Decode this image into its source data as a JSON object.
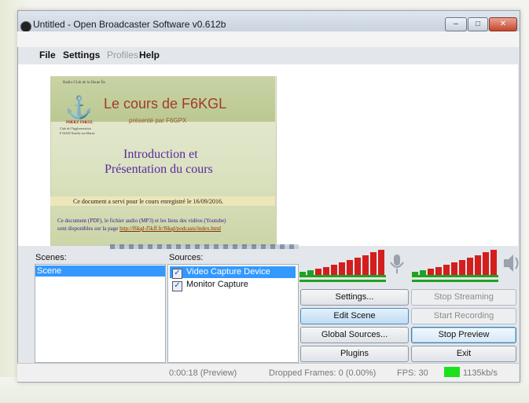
{
  "window": {
    "title": "Untitled - Open Broadcaster Software v0.612b",
    "controls": {
      "minimize": "–",
      "maximize": "□",
      "close": "✕"
    }
  },
  "menu": [
    {
      "label": "File",
      "enabled": true
    },
    {
      "label": "Settings",
      "enabled": true
    },
    {
      "label": "Profiles",
      "enabled": false
    },
    {
      "label": "Help",
      "enabled": true
    }
  ],
  "preview_slide": {
    "small_header": "Radio-Club de la Haute Île",
    "logo_text": "F6KKZ F6KGL",
    "logo_sub1": "Club de l'Agglomeration",
    "logo_sub2": "F-94100 Neuilly-sur-Marne",
    "title": "Le cours de F6KGL",
    "subtitle": "présenté par F6GPX",
    "intro_line1": "Introduction et",
    "intro_line2": "Présentation  du cours",
    "note": "Ce document a servi pour le cours enregistré le 16/09/2016.",
    "info_line1": "Ce document (PDF), le fichier audio (MP3) et les liens des vidéos (Youtube)",
    "info_line2_prefix": "sont disponibles sur la page ",
    "info_link": "http://f6kgl-f5kff.fr/f6kgl/podcasts/index.html"
  },
  "scenes": {
    "label": "Scenes:",
    "items": [
      "Scene"
    ],
    "selected": 0
  },
  "sources": {
    "label": "Sources:",
    "items": [
      {
        "name": "Video Capture Device",
        "checked": true,
        "selected": true
      },
      {
        "name": "Monitor Capture",
        "checked": true,
        "selected": false
      }
    ]
  },
  "audio": {
    "mic_icon": "microphone-icon",
    "speaker_icon": "speaker-icon",
    "meter_colors": {
      "low": "#1fa31f",
      "high": "#d41e1e"
    }
  },
  "buttons": {
    "settings": "Settings...",
    "edit_scene": "Edit Scene",
    "global_sources": "Global Sources...",
    "plugins": "Plugins",
    "stop_streaming": "Stop Streaming",
    "start_recording": "Start Recording",
    "stop_preview": "Stop Preview",
    "exit": "Exit"
  },
  "status": {
    "time": "0:00:18 (Preview)",
    "dropped_frames": "Dropped Frames: 0 (0.00%)",
    "fps": "FPS: 30",
    "bitrate": "1135kb/s",
    "bitrate_color": "#1ee11e"
  }
}
